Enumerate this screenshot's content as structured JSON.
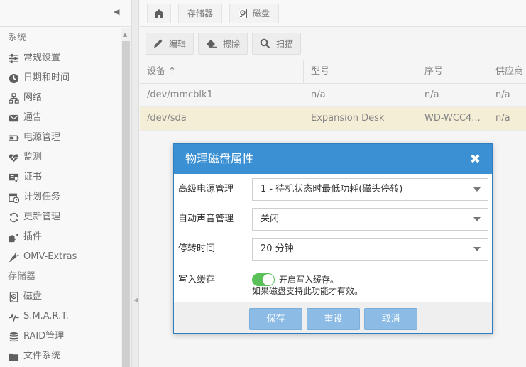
{
  "sidebar": {
    "collapse_icon": "chevron-left-icon",
    "items": [
      {
        "type": "section",
        "label": "系统"
      },
      {
        "type": "item",
        "label": "常规设置",
        "icon": "sliders-icon"
      },
      {
        "type": "item",
        "label": "日期和时间",
        "icon": "clock-icon"
      },
      {
        "type": "item",
        "label": "网络",
        "icon": "network-icon"
      },
      {
        "type": "item",
        "label": "通告",
        "icon": "envelope-icon"
      },
      {
        "type": "item",
        "label": "电源管理",
        "icon": "battery-icon"
      },
      {
        "type": "item",
        "label": "监测",
        "icon": "heartbeat-icon"
      },
      {
        "type": "item",
        "label": "证书",
        "icon": "certificate-icon"
      },
      {
        "type": "item",
        "label": "计划任务",
        "icon": "calendar-clock-icon"
      },
      {
        "type": "item",
        "label": "更新管理",
        "icon": "refresh-icon"
      },
      {
        "type": "item",
        "label": "插件",
        "icon": "puzzle-icon"
      },
      {
        "type": "item",
        "label": "OMV-Extras",
        "icon": "plug-icon"
      },
      {
        "type": "section",
        "label": "存储器"
      },
      {
        "type": "item",
        "label": "磁盘",
        "icon": "disk-icon"
      },
      {
        "type": "item",
        "label": "S.M.A.R.T.",
        "icon": "pulse-icon"
      },
      {
        "type": "item",
        "label": "RAID管理",
        "icon": "database-icon"
      },
      {
        "type": "item",
        "label": "文件系统",
        "icon": "folder-icon"
      }
    ]
  },
  "breadcrumb": {
    "home_icon": "home-icon",
    "storage": "存储器",
    "disks": "磁盘",
    "disks_icon": "disk-icon"
  },
  "toolbar": {
    "edit": "编辑",
    "wipe": "擦除",
    "scan": "扫描"
  },
  "grid": {
    "columns": [
      "设备",
      "型号",
      "序号",
      "供应商"
    ],
    "sort_indicator": "↑",
    "rows": [
      {
        "device": "/dev/mmcblk1",
        "model": "n/a",
        "serial": "n/a",
        "vendor": "n/a",
        "selected": false
      },
      {
        "device": "/dev/sda",
        "model": "Expansion Desk",
        "serial": "WD-WCC4...",
        "vendor": "n/a",
        "selected": true
      }
    ]
  },
  "dialog": {
    "title": "物理磁盘属性",
    "close_icon": "close-icon",
    "apm_label": "高级电源管理",
    "apm_value": "1 - 待机状态时最低功耗(磁头停转)",
    "aam_label": "自动声音管理",
    "aam_value": "关闭",
    "spindown_label": "停转时间",
    "spindown_value": "20 分钟",
    "write_cache_label": "写入缓存",
    "write_cache_on": true,
    "write_cache_toggle_text": "开启写入缓存。",
    "write_cache_hint": "如果磁盘支持此功能才有效。",
    "save": "保存",
    "reset": "重设",
    "cancel": "取消"
  },
  "colors": {
    "dialog_header": "#3b8fd3",
    "button": "#8cbce6",
    "toggle_on": "#5ac05a",
    "selected_row": "#f2e8c8"
  }
}
